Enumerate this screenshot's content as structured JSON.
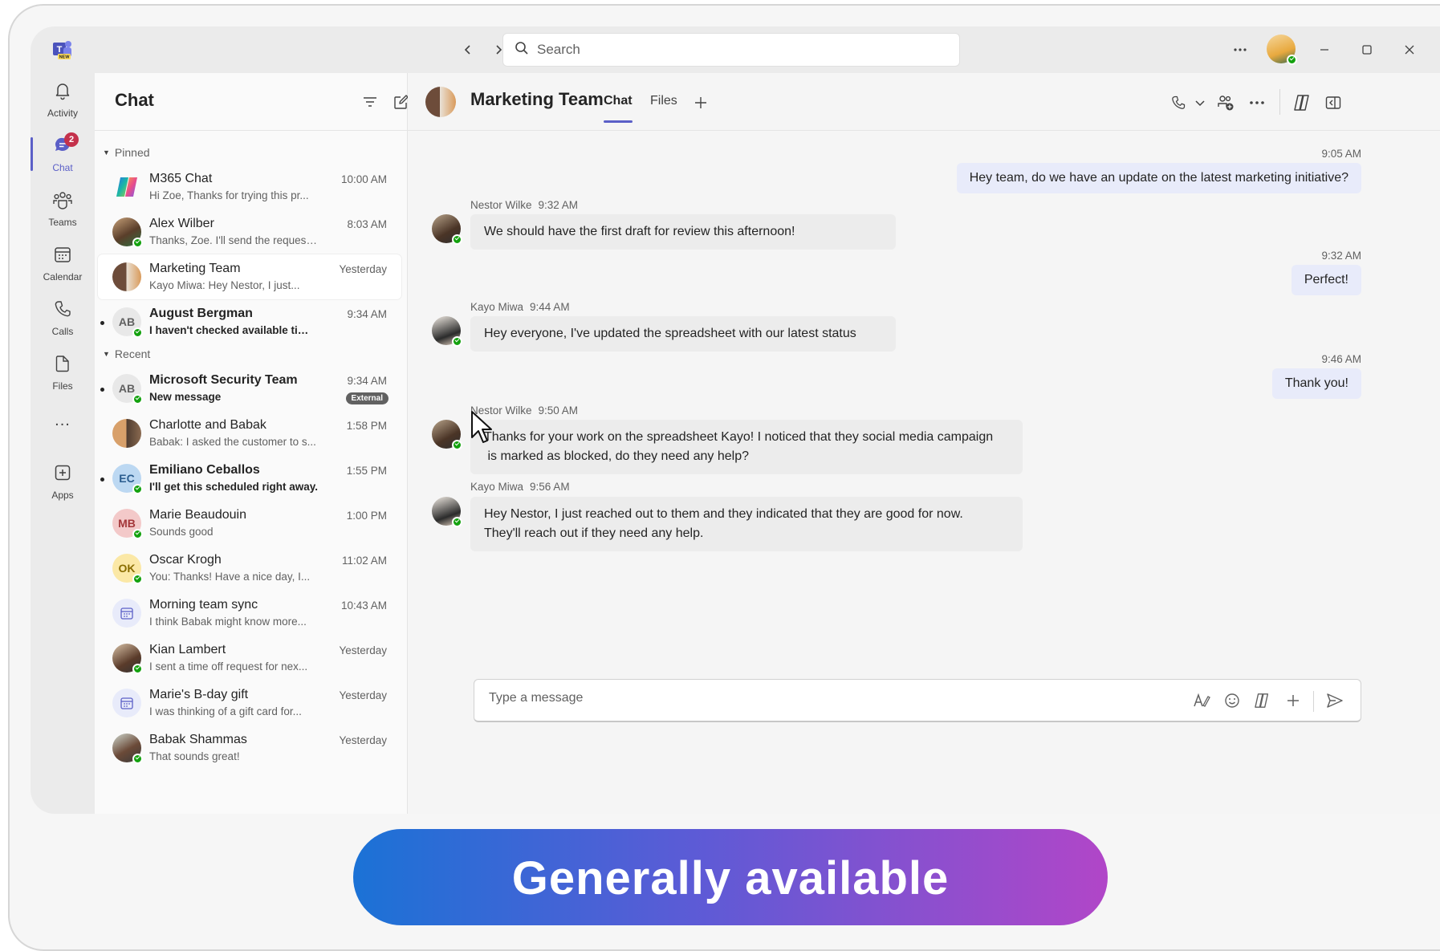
{
  "titlebar": {
    "search_placeholder": "Search",
    "logo_badge": "NEW",
    "icons": [
      "teams-logo-icon",
      "back-arrow-icon",
      "forward-arrow-icon",
      "search-icon",
      "more-icon",
      "minimize-icon",
      "maximize-icon",
      "close-icon"
    ]
  },
  "rail": {
    "items": [
      {
        "label": "Activity",
        "icon": "bell-icon"
      },
      {
        "label": "Chat",
        "icon": "chat-icon",
        "badge": "2"
      },
      {
        "label": "Teams",
        "icon": "teams-icon"
      },
      {
        "label": "Calendar",
        "icon": "calendar-icon"
      },
      {
        "label": "Calls",
        "icon": "phone-icon"
      },
      {
        "label": "Files",
        "icon": "file-icon"
      },
      {
        "label": "Apps",
        "icon": "add-app-icon"
      }
    ],
    "more": "..."
  },
  "chat_list": {
    "title": "Chat",
    "pinned_label": "Pinned",
    "recent_label": "Recent",
    "pinned": [
      {
        "name": "M365 Chat",
        "preview": "Hi Zoe, Thanks for trying this pr...",
        "time": "10:00 AM"
      },
      {
        "name": "Alex Wilber",
        "preview": "Thanks, Zoe. I'll send the request...",
        "time": "8:03 AM"
      },
      {
        "name": "Marketing Team",
        "preview": "Kayo Miwa: Hey Nestor, I just...",
        "time": "Yesterday"
      },
      {
        "name": "August Bergman",
        "preview": "I haven't checked available time...",
        "time": "9:34 AM",
        "initials": "AB"
      }
    ],
    "recent": [
      {
        "name": "Microsoft Security Team",
        "preview": "New message",
        "time": "9:34 AM",
        "initials": "AB",
        "badge": "External"
      },
      {
        "name": "Charlotte and Babak",
        "preview": "Babak: I asked the customer to s...",
        "time": "1:58 PM"
      },
      {
        "name": "Emiliano Ceballos",
        "preview": "I'll get this scheduled right away.",
        "time": "1:55 PM",
        "initials": "EC"
      },
      {
        "name": "Marie Beaudouin",
        "preview": "Sounds good",
        "time": "1:00 PM",
        "initials": "MB"
      },
      {
        "name": "Oscar Krogh",
        "preview": "You: Thanks! Have a nice day, I...",
        "time": "11:02 AM",
        "initials": "OK"
      },
      {
        "name": "Morning team sync",
        "preview": "I think Babak might know more...",
        "time": "10:43 AM"
      },
      {
        "name": "Kian Lambert",
        "preview": "I sent a time off request for nex...",
        "time": "Yesterday"
      },
      {
        "name": "Marie's B-day gift",
        "preview": "I was thinking of a gift card for...",
        "time": "Yesterday"
      },
      {
        "name": "Babak Shammas",
        "preview": "That sounds great!",
        "time": "Yesterday"
      }
    ]
  },
  "conversation": {
    "title": "Marketing Team",
    "tabs": [
      "Chat",
      "Files"
    ],
    "messages": [
      {
        "time": "9:05 AM",
        "text": "Hey team, do we have an update on the latest marketing initiative?"
      },
      {
        "sender": "Nestor Wilke",
        "time": "9:32 AM",
        "text": "We should have the first draft for review this afternoon!"
      },
      {
        "time": "9:32 AM",
        "text": "Perfect!"
      },
      {
        "sender": "Kayo Miwa",
        "time": "9:44 AM",
        "text": "Hey everyone, I've updated the spreadsheet with our latest status"
      },
      {
        "time": "9:46 AM",
        "text": "Thank you!"
      },
      {
        "sender": "Nestor Wilke",
        "time": "9:50 AM",
        "line1": "Thanks for your work on the spreadsheet Kayo! I noticed that they social media campaign",
        "line2": " is marked as blocked, do they need any help?"
      },
      {
        "sender": "Kayo Miwa",
        "time": "9:56 AM",
        "line1": "Hey Nestor, I just reached out to them and they indicated that they are good for now.",
        "line2": "They'll reach out if they need any help."
      }
    ],
    "composer_placeholder": "Type a message"
  },
  "banner": {
    "text": "Generally available"
  },
  "colors": {
    "accent": "#5b5fc7",
    "presence": "#13a10e",
    "badge": "#c4314b",
    "outgoing_bubble": "#e8ebfa"
  }
}
